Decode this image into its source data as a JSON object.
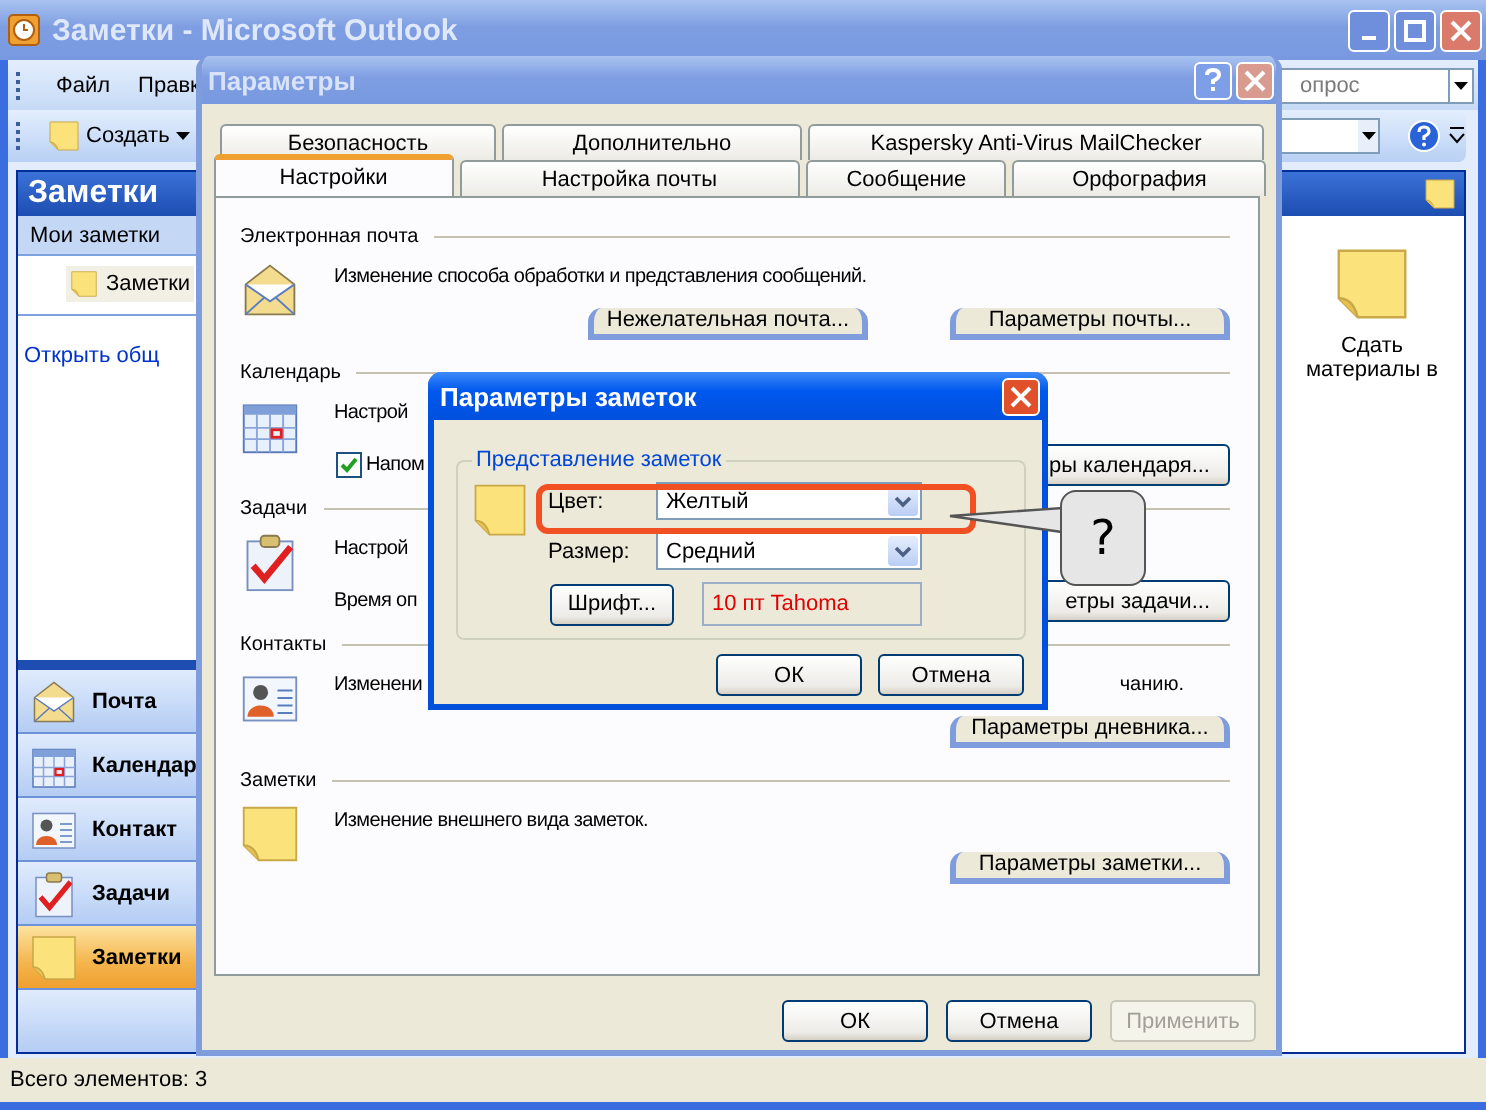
{
  "outlook": {
    "title": "Заметки - Microsoft Outlook",
    "menu": [
      "Файл",
      "Правк"
    ],
    "help_box": {
      "placeholder": "опрос"
    },
    "toolbar": {
      "new_button": "Создать"
    },
    "nav": {
      "title": "Заметки",
      "section": "Мои заметки",
      "folders": [
        {
          "label": "Заметки",
          "selected": true
        }
      ],
      "link": "Открыть общ",
      "buttons": [
        {
          "label": "Почта",
          "kind": "mail",
          "selected": false
        },
        {
          "label": "Календар",
          "kind": "calendar",
          "selected": false
        },
        {
          "label": "Контакт",
          "kind": "contacts",
          "selected": false
        },
        {
          "label": "Задачи",
          "kind": "tasks",
          "selected": false
        },
        {
          "label": "Заметки",
          "kind": "note",
          "selected": true
        }
      ]
    },
    "notes": [
      {
        "label": "Сдать материалы в"
      }
    ],
    "status_bar": "Всего элементов: 3"
  },
  "options": {
    "title": "Параметры",
    "tab_rows": [
      [
        {
          "label": "Безопасность",
          "selected": false
        },
        {
          "label": "Дополнительно",
          "selected": false
        },
        {
          "label": "Kaspersky Anti-Virus MailChecker",
          "selected": false
        }
      ],
      [
        {
          "label": "Настройки",
          "selected": true
        },
        {
          "label": "Настройка почты",
          "selected": false
        },
        {
          "label": "Сообщение",
          "selected": false
        },
        {
          "label": "Орфография",
          "selected": false
        }
      ]
    ],
    "sections": [
      {
        "title": "Электронная почта",
        "kind": "mail",
        "rows": [
          {
            "kind": "text",
            "text": "Изменение способа обработки и представления сообщений."
          },
          {
            "kind": "buttons",
            "buttons": [
              "Нежелательная почта...",
              "Параметры почты..."
            ]
          }
        ]
      },
      {
        "title": "Календарь",
        "kind": "calendar",
        "rows": [
          {
            "kind": "text",
            "text": "Настрой"
          },
          {
            "kind": "checkbox",
            "label": "Напом",
            "checked": true,
            "button": "ры календаря..."
          }
        ]
      },
      {
        "title": "Задачи",
        "kind": "tasks",
        "rows": [
          {
            "kind": "text",
            "text": "Настрой"
          },
          {
            "kind": "text",
            "text": "Время оп",
            "button": "етры задачи..."
          }
        ]
      },
      {
        "title": "Контакты",
        "kind": "contacts",
        "rows": [
          {
            "kind": "text",
            "text": "Изменени",
            "right_text": "чанию."
          },
          {
            "kind": "buttons",
            "buttons": [
              "Параметры дневника..."
            ]
          }
        ]
      },
      {
        "title": "Заметки",
        "kind": "note",
        "rows": [
          {
            "kind": "text",
            "text": "Изменение внешнего вида заметок."
          },
          {
            "kind": "buttons",
            "buttons": [
              "Параметры заметки..."
            ]
          }
        ]
      }
    ],
    "buttons": [
      {
        "label": "ОК",
        "disabled": false
      },
      {
        "label": "Отмена",
        "disabled": false
      },
      {
        "label": "Применить",
        "disabled": true
      }
    ]
  },
  "note_options": {
    "title": "Параметры заметок",
    "group": "Представление заметок",
    "color": {
      "label": "Цвет:",
      "value": "Желтый"
    },
    "size": {
      "label": "Размер:",
      "value": "Средний"
    },
    "font_button": "Шрифт...",
    "font_preview": "10 пт Tahoma",
    "buttons": [
      "ОК",
      "Отмена"
    ]
  },
  "callout": {
    "text": "?"
  }
}
